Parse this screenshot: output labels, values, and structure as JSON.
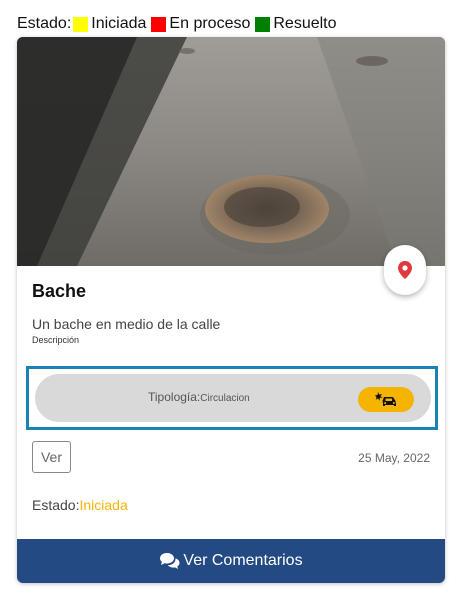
{
  "legend": {
    "label": "Estado:",
    "items": [
      {
        "label": "Iniciada",
        "color": "#ffff00"
      },
      {
        "label": "En proceso",
        "color": "#ff0000"
      },
      {
        "label": "Resuelto",
        "color": "#008000"
      }
    ]
  },
  "card": {
    "image_icon": "pothole-photo",
    "map_icon": "map-pin-icon",
    "title": "Bache",
    "description": "Un bache en medio de la calle",
    "description_label": "Descripción",
    "tipologia_label": "Tipología:",
    "tipologia_value": "Circulacion",
    "tipologia_icon": "car-crash-icon",
    "view_label": "Ver",
    "date": "25 May, 2022",
    "estado_label": "Estado:",
    "estado_value": "Iniciada",
    "comments_label": "Ver Comentarios",
    "comments_icon": "comments-icon"
  },
  "colors": {
    "primary": "#234a82",
    "status_iniciada": "#f5b400",
    "highlight_border": "#1a83b5",
    "map_pin": "#e0393e"
  }
}
